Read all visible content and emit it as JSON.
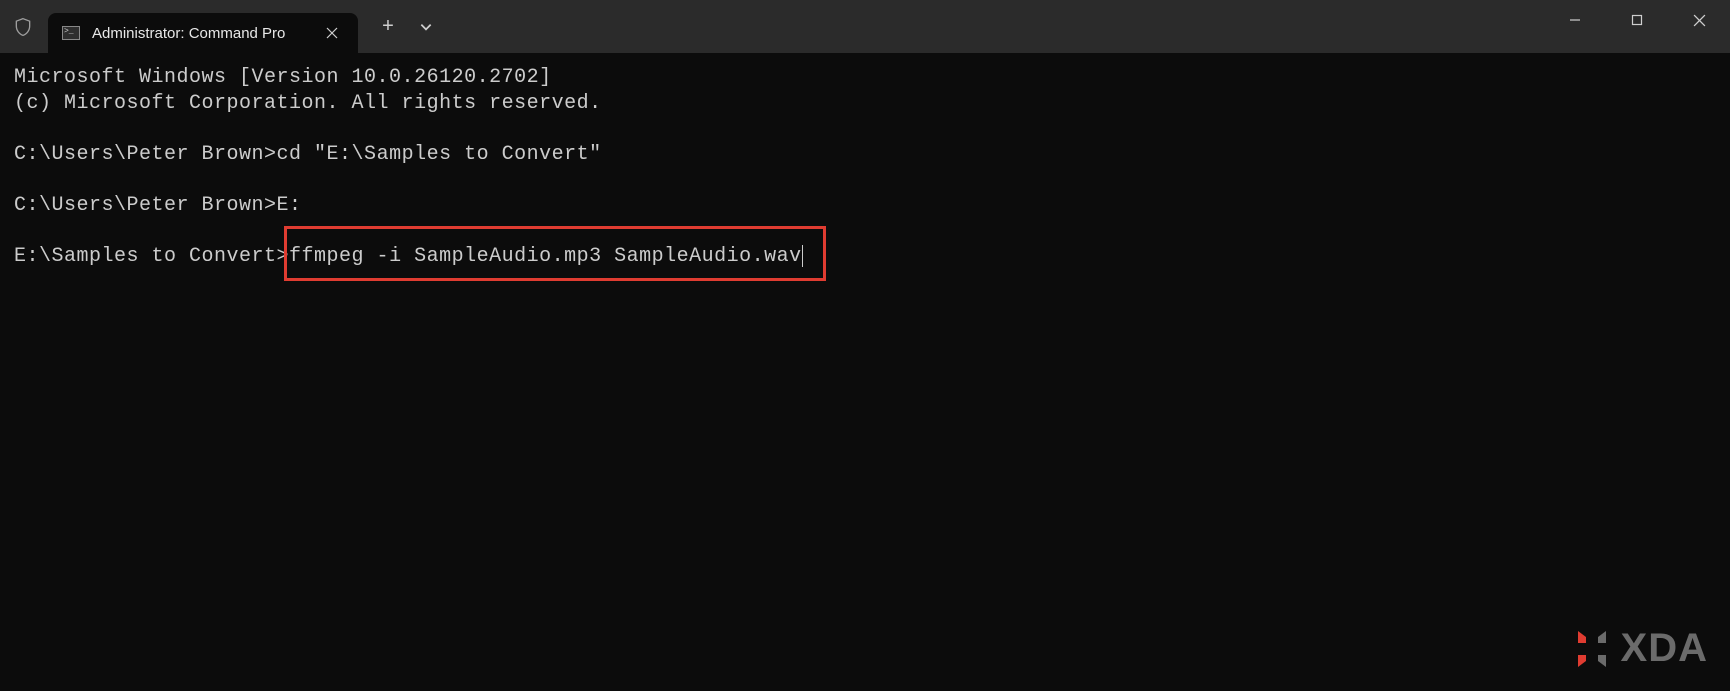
{
  "tab": {
    "title": "Administrator: Command Pro"
  },
  "terminal": {
    "line1": "Microsoft Windows [Version 10.0.26120.2702]",
    "line2": "(c) Microsoft Corporation. All rights reserved.",
    "line3_prompt": "C:\\Users\\Peter Brown>",
    "line3_cmd": "cd \"E:\\Samples to Convert\"",
    "line4_prompt": "C:\\Users\\Peter Brown>",
    "line4_cmd": "E:",
    "line5_prompt": "E:\\Samples to Convert>",
    "line5_cmd": "ffmpeg -i SampleAudio.mp3 SampleAudio.wav"
  },
  "watermark": {
    "text": "XDA"
  }
}
